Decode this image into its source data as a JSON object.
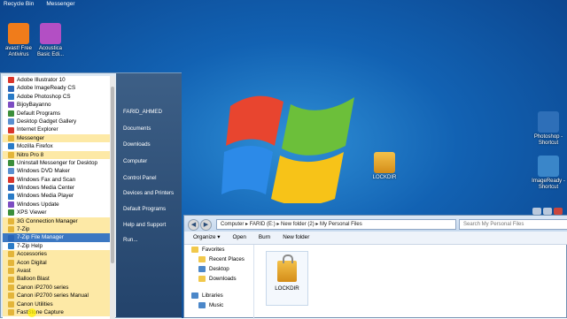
{
  "desktop": {
    "top_labels": [
      "Recycle Bin",
      "Messenger"
    ],
    "icons_left": [
      {
        "label": "avast! Free Antivirus",
        "color": "#f07c1b"
      },
      {
        "label": "Acoustica Basic Edi...",
        "color": "#b34fc4"
      }
    ],
    "icons_right": [
      {
        "label": "Photoshop - Shortcut",
        "color": "#2e6fb8"
      },
      {
        "label": "ImageReady - Shortcut",
        "color": "#3a86c9"
      }
    ],
    "lockdir_label": "LOCKDIR"
  },
  "start_menu": {
    "programs": [
      {
        "label": "Adobe Illustrator 10",
        "type": "app"
      },
      {
        "label": "Adobe ImageReady CS",
        "type": "app"
      },
      {
        "label": "Adobe Photoshop CS",
        "type": "app"
      },
      {
        "label": "BijoyBayanno",
        "type": "app"
      },
      {
        "label": "Default Programs",
        "type": "app"
      },
      {
        "label": "Desktop Gadget Gallery",
        "type": "app"
      },
      {
        "label": "Internet Explorer",
        "type": "app"
      },
      {
        "label": "Messenger",
        "type": "folder"
      },
      {
        "label": "Mozilla Firefox",
        "type": "app"
      },
      {
        "label": "Nitro Pro 8",
        "type": "folder"
      },
      {
        "label": "Uninstall Messenger for Desktop",
        "type": "app"
      },
      {
        "label": "Windows DVD Maker",
        "type": "app"
      },
      {
        "label": "Windows Fax and Scan",
        "type": "app"
      },
      {
        "label": "Windows Media Center",
        "type": "app"
      },
      {
        "label": "Windows Media Player",
        "type": "app"
      },
      {
        "label": "Windows Update",
        "type": "app"
      },
      {
        "label": "XPS Viewer",
        "type": "app"
      },
      {
        "label": "3G Connection Manager",
        "type": "folder"
      },
      {
        "label": "7-Zip",
        "type": "folder"
      },
      {
        "label": "7-Zip File Manager",
        "type": "selected"
      },
      {
        "label": "7-Zip Help",
        "type": "app"
      },
      {
        "label": "Accessories",
        "type": "folder"
      },
      {
        "label": "Acon Digital",
        "type": "folder"
      },
      {
        "label": "Avast",
        "type": "folder"
      },
      {
        "label": "Balloon Blast",
        "type": "folder"
      },
      {
        "label": "Canon iP2700 series",
        "type": "folder"
      },
      {
        "label": "Canon iP2700 series Manual",
        "type": "folder"
      },
      {
        "label": "Canon Utilities",
        "type": "folder"
      },
      {
        "label": "FastStone Capture",
        "type": "folder"
      }
    ],
    "right_items": [
      "FARID_AHMED",
      "Documents",
      "Downloads",
      "Computer",
      "Control Panel",
      "Devices and Printers",
      "Default Programs",
      "Help and Support",
      "Run..."
    ]
  },
  "explorer": {
    "path": "Computer ▸ FARID (E:) ▸ New folder (2) ▸ My Personal Files",
    "search_placeholder": "Search My Personal Files",
    "commands": [
      "Organize ▾",
      "Open",
      "Burn",
      "New folder"
    ],
    "nav_items": [
      "Favorites",
      "Recent Places",
      "Desktop",
      "Downloads",
      "Libraries",
      "Music"
    ],
    "file_label": "LOCKDIR"
  }
}
